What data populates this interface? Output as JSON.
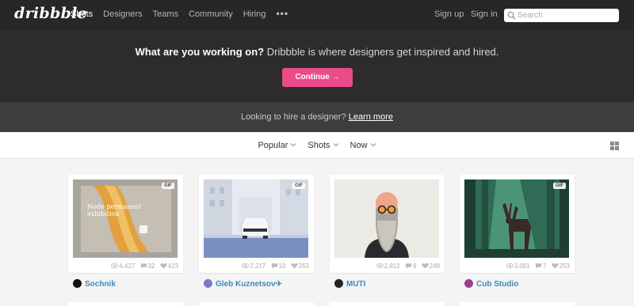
{
  "brand": {
    "logo_text": "dribbble"
  },
  "nav": {
    "items": [
      "Shots",
      "Designers",
      "Teams",
      "Community",
      "Hiring"
    ],
    "more": "•••"
  },
  "auth": {
    "signup": "Sign up",
    "signin": "Sign in"
  },
  "search": {
    "placeholder": "Search"
  },
  "hero": {
    "question": "What are you working on?",
    "tagline": " Dribbble is where designers get inspired and hired.",
    "button": "Continue →",
    "accent": "#ea4c89"
  },
  "hire": {
    "text": "Looking to hire a designer?",
    "link": "Learn more"
  },
  "filters": [
    "Popular",
    "Shots",
    "Now"
  ],
  "shots": [
    {
      "gif": "GIF",
      "image_text": "Node permanent exhibition",
      "views": "4,427",
      "comments": "32",
      "likes": "423",
      "author": "Sochnik",
      "avatar_color": "#111111"
    },
    {
      "gif": "GIF",
      "views": "2,217",
      "comments": "10",
      "likes": "263",
      "author": "Gleb Kuznetsov✈",
      "avatar_color": "#7a7acc"
    },
    {
      "views": "2,812",
      "comments": "6",
      "likes": "249",
      "author": "MUTI",
      "avatar_color": "#222222"
    },
    {
      "gif": "GIF",
      "views": "3,081",
      "comments": "7",
      "likes": "253",
      "author": "Cub Studio",
      "avatar_color": "#9b3f8e"
    }
  ],
  "icons": {
    "search": "search-icon",
    "chevron": "chevron-down-icon",
    "grid": "grid-icon",
    "views": "eye-icon",
    "comments": "comment-icon",
    "likes": "heart-icon"
  }
}
